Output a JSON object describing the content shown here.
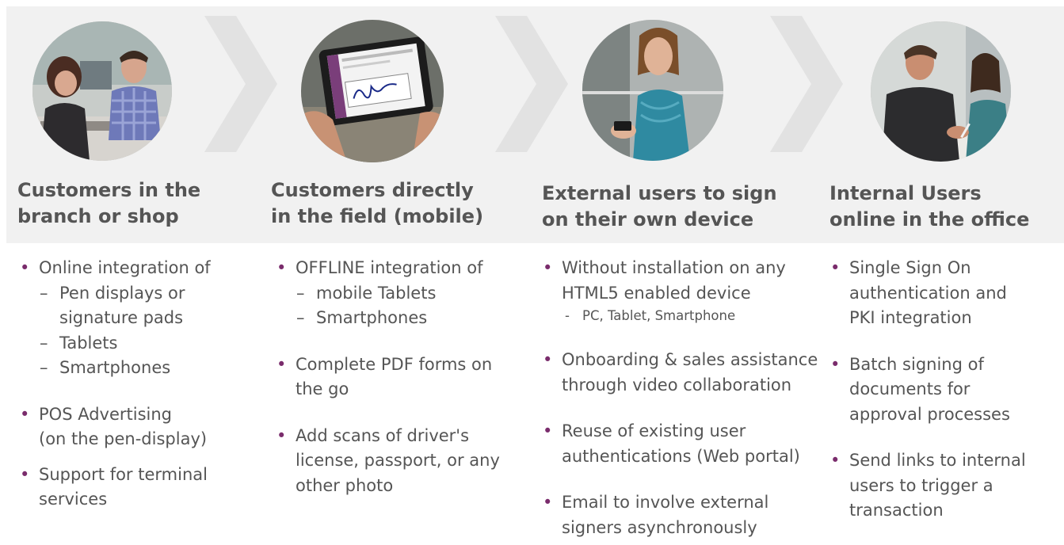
{
  "colors": {
    "band": "#f1f1f1",
    "text": "#555555",
    "bullet": "#7a2c6c"
  },
  "columns": [
    {
      "title_line1": "Customers in the",
      "title_line2": "branch or shop",
      "photo_icon": "branch-signing-photo",
      "items": [
        {
          "level": 1,
          "text": "Online integration of"
        },
        {
          "level": 2,
          "text": "Pen displays or"
        },
        {
          "level": 2,
          "text": "signature pads",
          "continuation": true
        },
        {
          "level": 2,
          "text": "Tablets"
        },
        {
          "level": 2,
          "text": "Smartphones"
        },
        {
          "level": 1,
          "text": "POS Advertising",
          "gap": "large"
        },
        {
          "level": 1,
          "text": "(on the pen-display)",
          "continuation": true
        },
        {
          "level": 1,
          "text": "Support for terminal",
          "gap": "small"
        },
        {
          "level": 1,
          "text": "services",
          "continuation": true
        }
      ]
    },
    {
      "title_line1": "Customers directly",
      "title_line2": "in the field (mobile)",
      "photo_icon": "tablet-signature-photo",
      "items": [
        {
          "level": 1,
          "text": "OFFLINE integration of"
        },
        {
          "level": 2,
          "text": "mobile Tablets"
        },
        {
          "level": 2,
          "text": "Smartphones"
        },
        {
          "level": 1,
          "text": "Complete PDF forms on",
          "gap": "large"
        },
        {
          "level": 1,
          "text": "the go",
          "continuation": true
        },
        {
          "level": 1,
          "text": "Add scans of driver's",
          "gap": "large"
        },
        {
          "level": 1,
          "text": "license, passport, or any",
          "continuation": true
        },
        {
          "level": 1,
          "text": "other photo",
          "continuation": true
        }
      ]
    },
    {
      "title_line1": "External users to sign",
      "title_line2": "on their own device",
      "photo_icon": "smartphone-user-photo",
      "items": [
        {
          "level": 1,
          "text": "Without installation on any"
        },
        {
          "level": 1,
          "text": "HTML5 enabled device",
          "continuation": true
        },
        {
          "level": 3,
          "text": "PC, Tablet, Smartphone"
        },
        {
          "level": 1,
          "text": "Onboarding & sales assistance",
          "gap": "large"
        },
        {
          "level": 1,
          "text": "through video collaboration",
          "continuation": true
        },
        {
          "level": 1,
          "text": "Reuse of existing user",
          "gap": "large"
        },
        {
          "level": 1,
          "text": "authentications (Web portal)",
          "continuation": true
        },
        {
          "level": 1,
          "text": "Email to involve external",
          "gap": "large"
        },
        {
          "level": 1,
          "text": "signers asynchronously",
          "continuation": true
        }
      ]
    },
    {
      "title_line1": "Internal Users",
      "title_line2": "online in the office",
      "photo_icon": "office-team-photo",
      "items": [
        {
          "level": 1,
          "text": "Single Sign On"
        },
        {
          "level": 1,
          "text": "authentication and",
          "continuation": true
        },
        {
          "level": 1,
          "text": "PKI integration",
          "continuation": true
        },
        {
          "level": 1,
          "text": "Batch signing of",
          "gap": "large"
        },
        {
          "level": 1,
          "text": "documents for",
          "continuation": true
        },
        {
          "level": 1,
          "text": "approval processes",
          "continuation": true
        },
        {
          "level": 1,
          "text": "Send links to internal",
          "gap": "large"
        },
        {
          "level": 1,
          "text": "users to trigger a",
          "continuation": true
        },
        {
          "level": 1,
          "text": "transaction",
          "continuation": true
        }
      ]
    }
  ]
}
